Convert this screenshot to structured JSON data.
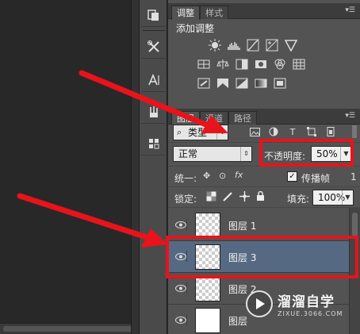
{
  "dock_tools": [
    "history-icon",
    "tools-icon",
    "character-icon",
    "brush-presets-icon",
    "3d-cube-icon"
  ],
  "adjust_panel": {
    "tabs": [
      "调整",
      "样式"
    ],
    "title": "添加调整",
    "icons_row1": [
      "brightness-icon",
      "levels-icon",
      "curves-icon",
      "exposure-icon",
      "vibrance-icon"
    ],
    "icons_row2": [
      "hue-saturation-icon",
      "color-balance-icon",
      "black-white-icon",
      "photo-filter-icon",
      "channel-mixer-icon",
      "color-lookup-icon"
    ],
    "icons_row3": [
      "invert-icon",
      "posterize-icon",
      "threshold-icon",
      "gradient-map-icon",
      "selective-color-icon"
    ]
  },
  "layers_panel": {
    "tabs": [
      "图层",
      "通道",
      "路径"
    ],
    "filter_type": "类型",
    "filter_icons": [
      "image-filter-icon",
      "adjustment-filter-icon",
      "type-filter-icon",
      "shape-filter-icon",
      "smart-object-filter-icon"
    ],
    "blend_mode": "正常",
    "opacity_label": "不透明度:",
    "opacity_value": "50%",
    "unify_label": "统一:",
    "propagate_label": "传播帧",
    "propagate_value": "1",
    "lock_label": "锁定:",
    "fill_label": "填充:",
    "fill_value": "100%",
    "layers": [
      {
        "name": "图层 1",
        "selected": false
      },
      {
        "name": "图层 3",
        "selected": true
      },
      {
        "name": "图层 2",
        "selected": false
      },
      {
        "name": "图层",
        "selected": false
      }
    ]
  },
  "colors": {
    "highlight": "#e8131b",
    "selected_row": "#566982"
  },
  "watermark": {
    "cn": "溜溜自学",
    "en": "ZIXUE.3066.COM"
  }
}
